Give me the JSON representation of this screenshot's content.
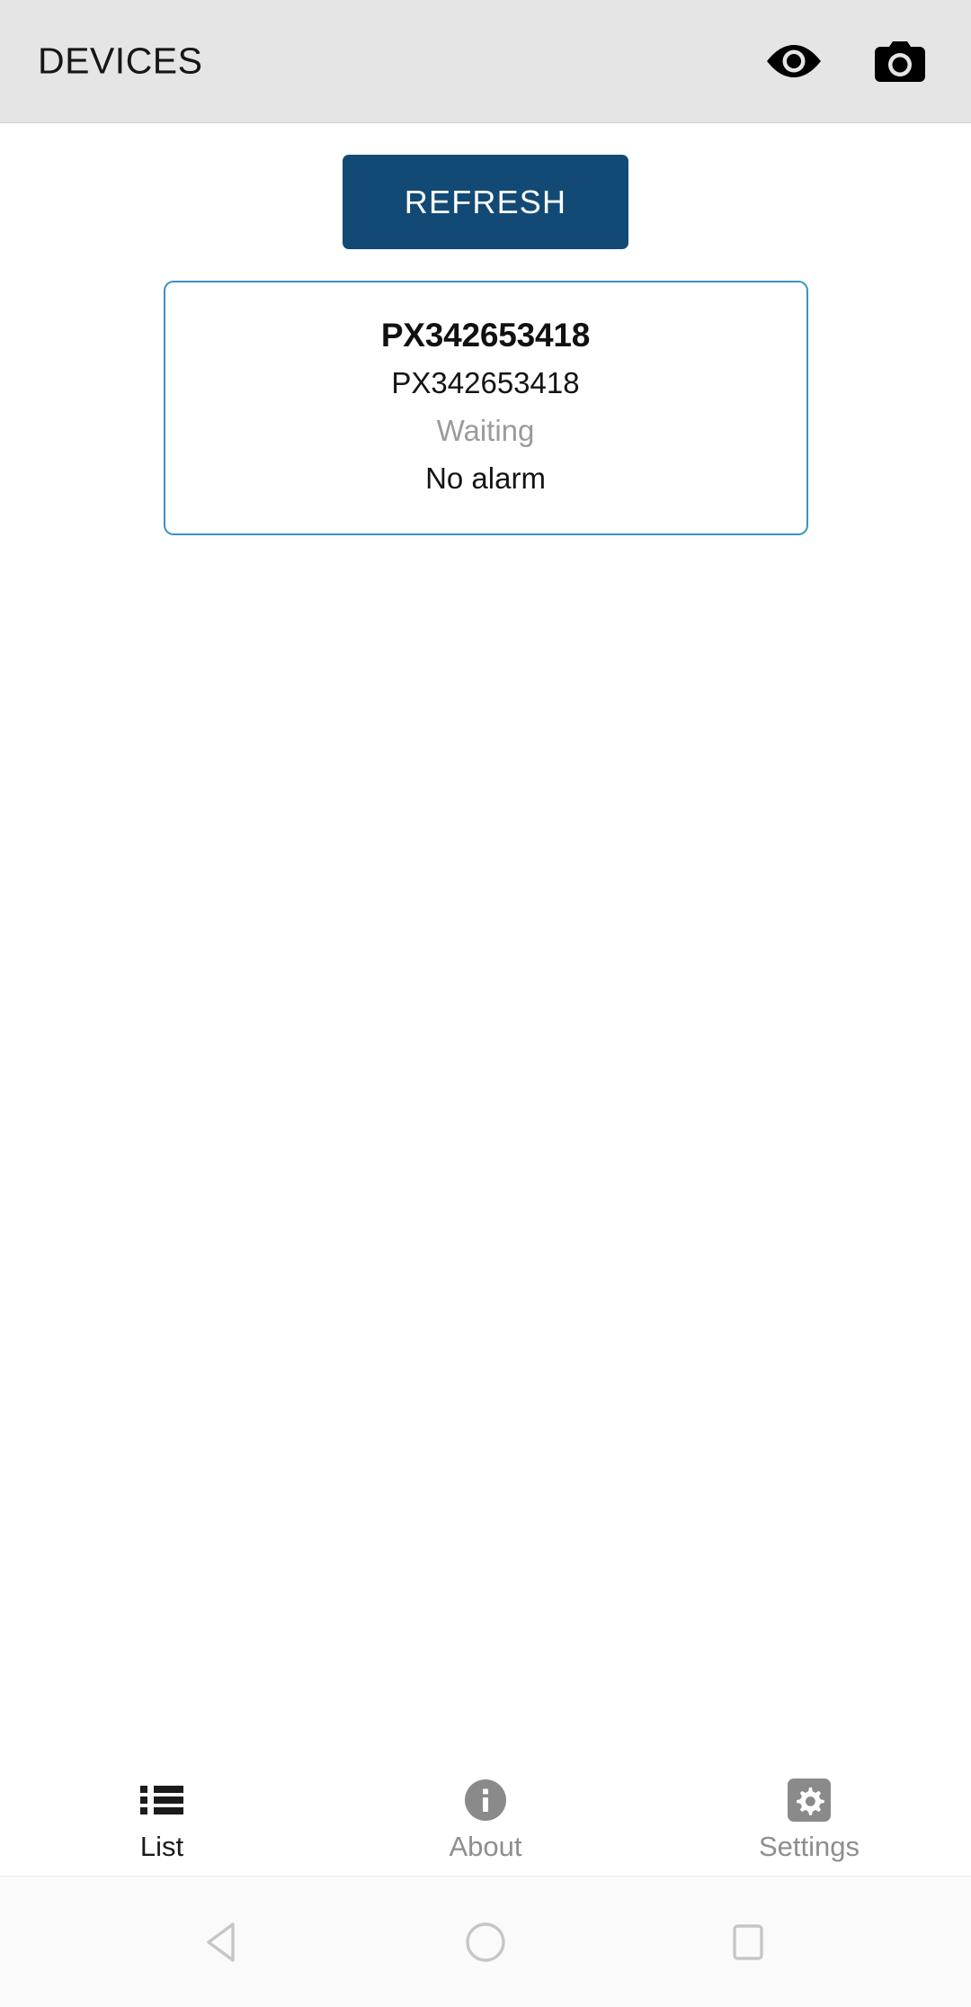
{
  "header": {
    "title": "DEVICES",
    "actions": [
      {
        "name": "eye-icon",
        "label": "Eye"
      },
      {
        "name": "camera-icon",
        "label": "Camera"
      }
    ],
    "background_color": "#e5e5e5"
  },
  "main": {
    "refresh_button_label": "REFRESH",
    "refresh_button_color": "#124a75",
    "card_border_color": "#3a92c4",
    "devices": [
      {
        "name": "PX342653418",
        "serial": "PX342653418",
        "status": "Waiting",
        "status_color": "#9b9b9b",
        "alarm": "No alarm"
      }
    ]
  },
  "tab_bar": {
    "items": [
      {
        "label": "List",
        "icon": "list-icon",
        "active": true
      },
      {
        "label": "About",
        "icon": "info-icon",
        "active": false
      },
      {
        "label": "Settings",
        "icon": "gear-icon",
        "active": false
      }
    ],
    "active_color": "#1b1b1b",
    "inactive_color": "#8e8e8e"
  },
  "system_nav": {
    "buttons": [
      {
        "name": "back-button",
        "icon": "triangle-back-icon"
      },
      {
        "name": "home-button",
        "icon": "circle-home-icon"
      },
      {
        "name": "recents-button",
        "icon": "square-recents-icon"
      }
    ],
    "icon_color": "#c6c6c6"
  }
}
